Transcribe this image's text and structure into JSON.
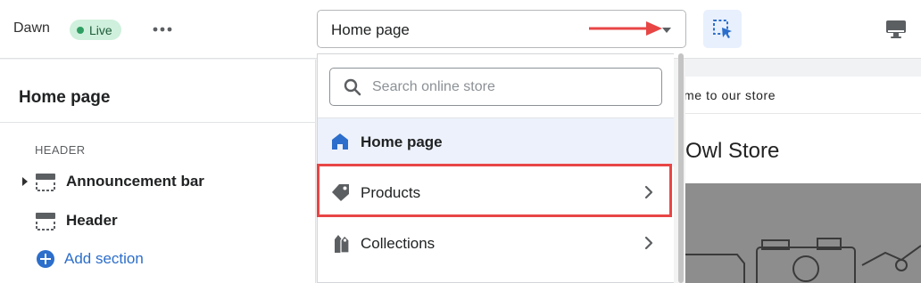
{
  "topbar": {
    "theme_name": "Dawn",
    "live_badge": "Live",
    "more_icon": "more-horizontal-icon",
    "page_select_value": "Home page",
    "inspector_icon": "select-element-icon",
    "desktop_icon": "desktop-icon",
    "accent_color": "#2c6ecb",
    "annotation_color": "#e84545"
  },
  "sidebar": {
    "title": "Home page",
    "group_label": "HEADER",
    "sections": [
      {
        "label": "Announcement bar",
        "icon": "section-layout-icon"
      },
      {
        "label": "Header",
        "icon": "section-layout-icon"
      }
    ],
    "add_section_label": "Add section",
    "add_icon": "plus-circle-icon"
  },
  "dropdown": {
    "search_placeholder": "Search online store",
    "items": [
      {
        "label": "Home page",
        "icon": "home-icon",
        "selected": true
      },
      {
        "label": "Products",
        "icon": "tag-icon",
        "highlighted": true
      },
      {
        "label": "Collections",
        "icon": "collections-icon"
      }
    ]
  },
  "preview": {
    "announcement_text": "me to our store",
    "store_name": "Owl Store"
  }
}
